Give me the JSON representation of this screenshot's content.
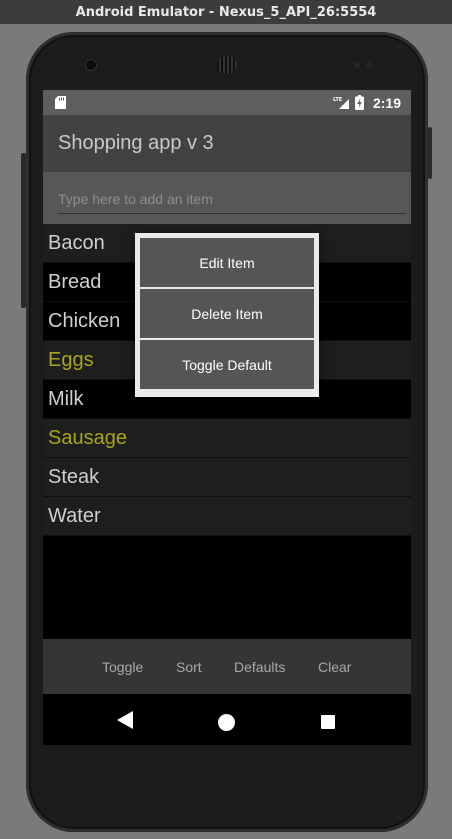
{
  "window": {
    "title": "Android Emulator - Nexus_5_API_26:5554"
  },
  "status_bar": {
    "time": "2:19",
    "network_label": "LTE",
    "icons": [
      "sd-card-icon",
      "lte-signal-icon",
      "battery-charging-icon"
    ]
  },
  "app_bar": {
    "title": "Shopping app v 3"
  },
  "add_item": {
    "placeholder": "Type here to add an item",
    "value": ""
  },
  "items": [
    {
      "label": "Bacon",
      "is_default": false
    },
    {
      "label": "Bread",
      "is_default": false
    },
    {
      "label": "Chicken",
      "is_default": false
    },
    {
      "label": "Eggs",
      "is_default": true
    },
    {
      "label": "Milk",
      "is_default": false
    },
    {
      "label": "Sausage",
      "is_default": true
    },
    {
      "label": "Steak",
      "is_default": false
    },
    {
      "label": "Water",
      "is_default": false
    }
  ],
  "context_menu": {
    "items": [
      {
        "label": "Edit Item"
      },
      {
        "label": "Delete Item"
      },
      {
        "label": "Toggle Default"
      }
    ]
  },
  "bottom_bar": {
    "toggle": "Toggle",
    "sort": "Sort",
    "defaults": "Defaults",
    "clear": "Clear"
  },
  "nav_bar": {
    "icons": [
      "back-icon",
      "home-icon",
      "recent-apps-icon"
    ]
  },
  "colors": {
    "default_item": "#a9a51b",
    "normal_item": "#cfcfcf",
    "app_bar": "#424242",
    "status_bar": "#5e5e5e"
  }
}
